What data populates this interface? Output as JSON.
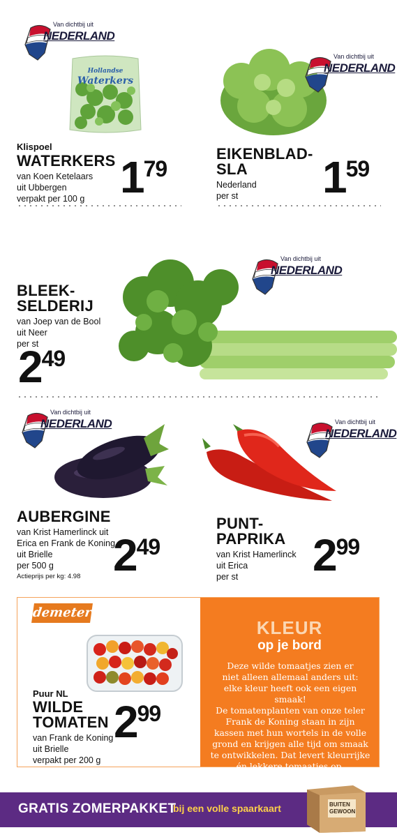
{
  "badge": {
    "top_text": "Van dichtbij uit",
    "main_text": "NEDERLAND"
  },
  "products": {
    "waterkers": {
      "pack_label_1": "Hollandse",
      "pack_label_2": "Waterkers",
      "brand": "Klispoel",
      "name": "WATERKERS",
      "desc_1": "van Koen Ketelaars",
      "desc_2": "uit Ubbergen",
      "desc_3": "verpakt per 100 g",
      "price_int": "1",
      "price_dec": "79"
    },
    "eikenblad": {
      "name_1": "EIKENBLAD-",
      "name_2": "SLA",
      "desc_1": "Nederland",
      "desc_2": "per st",
      "price_int": "1",
      "price_dec": "59"
    },
    "bleekselderij": {
      "name_1": "BLEEK-",
      "name_2": "SELDERIJ",
      "desc_1": "van Joep van de Bool",
      "desc_2": "uit Neer",
      "desc_3": "per st",
      "price_int": "2",
      "price_dec": "49"
    },
    "aubergine": {
      "name": "AUBERGINE",
      "desc_1": "van Krist Hamerlinck uit",
      "desc_2": "Erica en Frank de Koning",
      "desc_3": "uit Brielle",
      "desc_4": "per 500 g",
      "note": "Actieprijs per kg: 4.98",
      "price_int": "2",
      "price_dec": "49"
    },
    "puntpaprika": {
      "name_1": "PUNT-",
      "name_2": "PAPRIKA",
      "desc_1": "van Krist Hamerlinck",
      "desc_2": "uit Erica",
      "desc_3": "per st",
      "price_int": "2",
      "price_dec": "99"
    },
    "tomaten": {
      "certification": "demeter",
      "brand": "Puur NL",
      "name_1": "WILDE",
      "name_2": "TOMATEN",
      "desc_1": "van Frank de Koning",
      "desc_2": "uit Brielle",
      "desc_3": "verpakt per 200 g",
      "price_int": "2",
      "price_dec": "99"
    }
  },
  "story": {
    "title": "KLEUR",
    "subtitle": "op je bord",
    "lines": [
      "Deze wilde tomaatjes zien er",
      "niet alleen allemaal anders uit:",
      "elke kleur heeft ook een eigen smaak!",
      "De tomatenplanten van onze teler",
      "Frank de Koning staan in zijn",
      "kassen met hun wortels in de volle",
      "grond en krijgen alle tijd om smaak",
      "te ontwikkelen. Dat levert kleurrijke",
      "én lekkere tomaatjes op."
    ]
  },
  "banner": {
    "main": "GRATIS ZOMERPAKKET",
    "sub": "bij een volle spaarkaart",
    "box_label_1": "BUITEN",
    "box_label_2": "GEWOON"
  },
  "colors": {
    "story_bg": "#f47c20",
    "banner_bg": "#5c2b83",
    "banner_accent": "#fdd04a",
    "flag_red": "#c8102e",
    "flag_blue": "#21468b"
  }
}
